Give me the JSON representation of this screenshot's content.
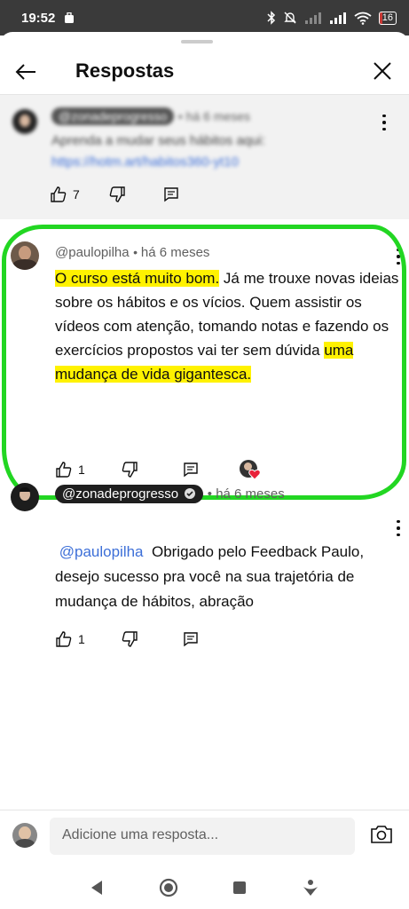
{
  "status": {
    "time": "19:52",
    "battery": "16"
  },
  "header": {
    "title": "Respostas"
  },
  "parent_comment": {
    "author": "@zonadeprogresso",
    "time": "há 6 meses",
    "text_line1": "Aprenda a mudar seus hábitos aqui:",
    "link": "https://hotm.art/habitos360-yt10",
    "likes": "7"
  },
  "reply1": {
    "author": "@paulopilha",
    "time": "há 6 meses",
    "text_hl1": "O curso está muito bom.",
    "text_mid": " Já me trouxe novas ideias sobre os hábitos e os vícios. Quem assistir os vídeos com atenção, tomando notas e fazendo os exercícios propostos vai ter sem dúvida ",
    "text_hl2": "uma mudança de vida gigantesca.",
    "likes": "1"
  },
  "reply2": {
    "author": "@zonadeprogresso",
    "time": "há 6 meses",
    "mention": "@paulopilha",
    "text": "Obrigado pelo Feedback Paulo, desejo sucesso pra você na sua trajetória de mudança de hábitos, abração",
    "likes": "1"
  },
  "reply_box": {
    "placeholder": "Adicione uma resposta..."
  },
  "colors": {
    "highlight": "#fff200",
    "annotation": "#22d622",
    "link": "#3d6fd8"
  }
}
